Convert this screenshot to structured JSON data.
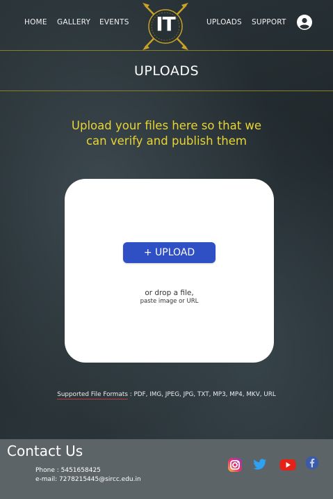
{
  "nav": {
    "home": "HOME",
    "gallery": "GALLERY",
    "events": "EVENTS",
    "logo_text": "IT",
    "uploads": "UPLOADS",
    "support": "SUPPORT"
  },
  "page": {
    "title": "UPLOADS",
    "headline_line1": "Upload your files here so that we",
    "headline_line2": "can verify and publish them"
  },
  "upload": {
    "button_label": "+ UPLOAD",
    "drop_text": "or drop a file,",
    "paste_text": "paste image or URL"
  },
  "formats": {
    "label": "Supported File Formats",
    "list": " : PDF, IMG, JPEG,  JPG, TXT, MP3, MP4, MKV, URL"
  },
  "footer": {
    "title": "Contact Us",
    "phone": "Phone : 5451658425",
    "email": "e-mail: 7278215445@sircc.edu.in"
  },
  "icons": {
    "user": "user-circle-icon",
    "instagram": "instagram-icon",
    "twitter": "twitter-icon",
    "youtube": "youtube-icon",
    "facebook": "facebook-icon"
  },
  "colors": {
    "accent_yellow": "#e8d534",
    "button_blue": "#2f4fc4",
    "footer_bg": "#5d6468"
  }
}
